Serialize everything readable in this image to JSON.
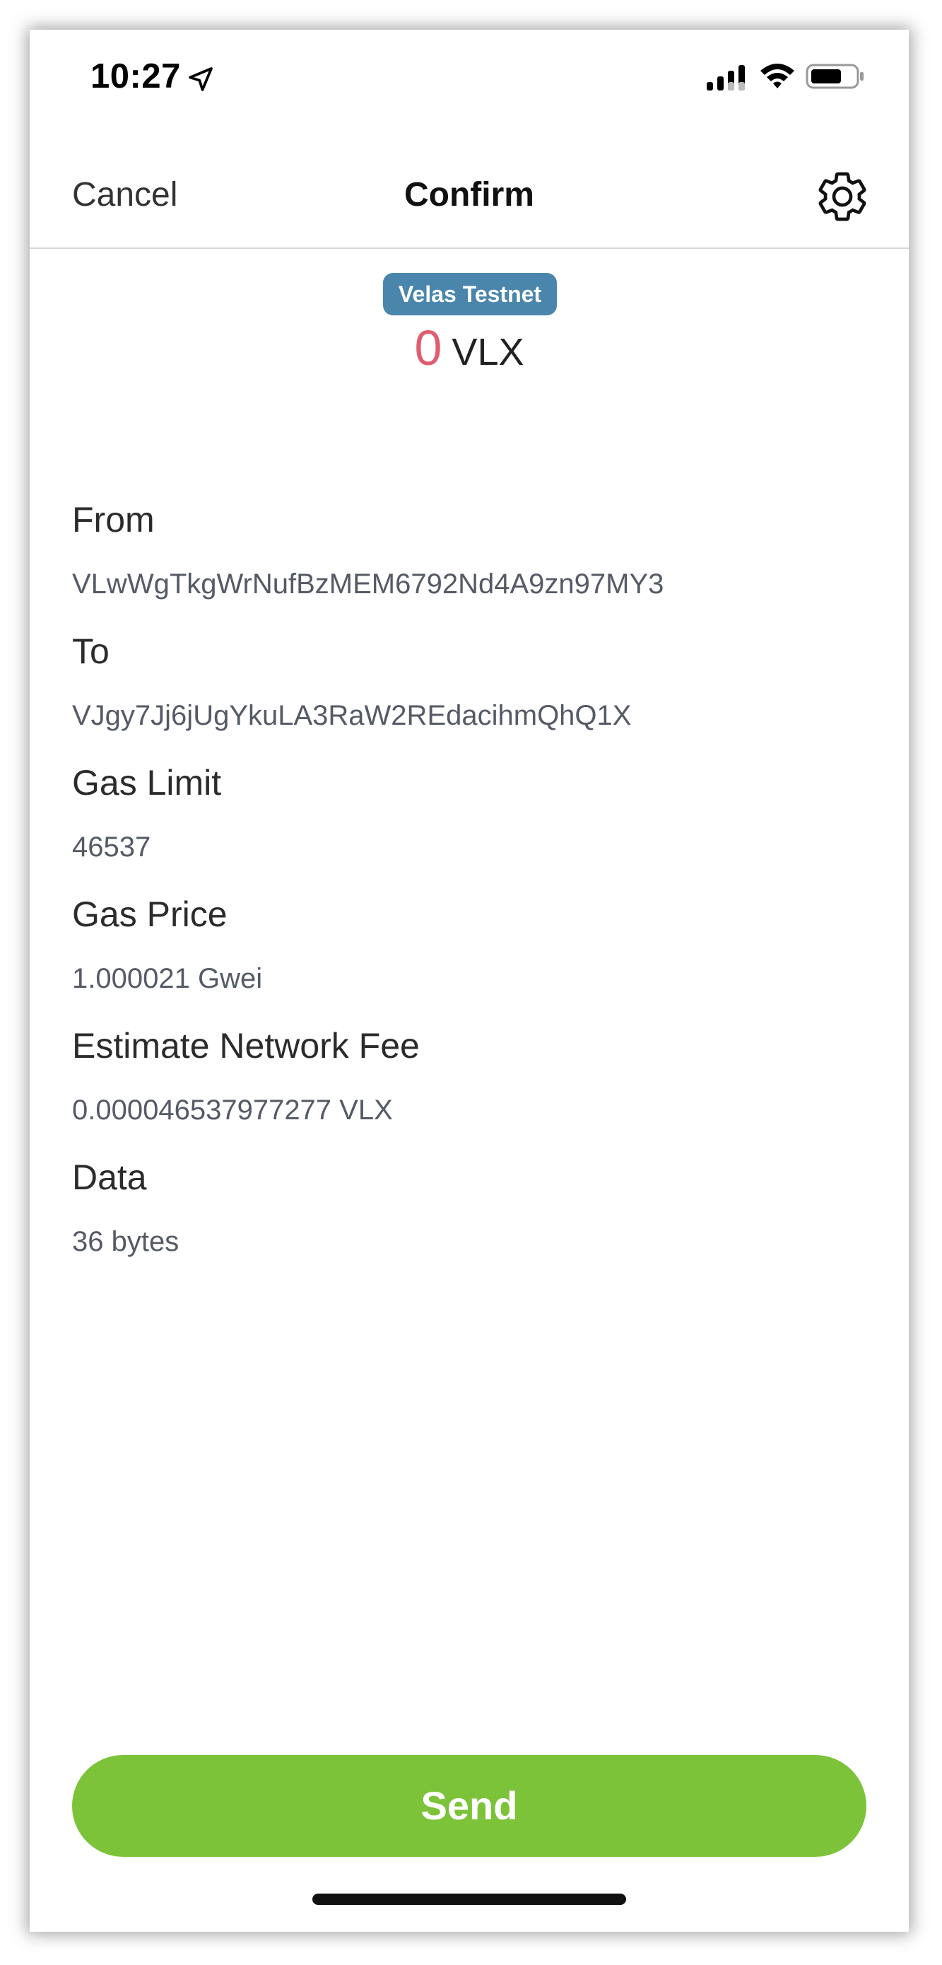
{
  "status_bar": {
    "time": "10:27",
    "icons": [
      "location-arrow-icon",
      "signal-icon",
      "wifi-icon",
      "battery-icon"
    ]
  },
  "nav": {
    "cancel_label": "Cancel",
    "title": "Confirm",
    "settings_icon": "gear-icon"
  },
  "network": {
    "name": "Velas Testnet",
    "color": "#4a86ac"
  },
  "amount": {
    "value": "0",
    "unit": "VLX",
    "value_color": "#e05c6e"
  },
  "fields": {
    "from": {
      "label": "From",
      "value": "VLwWgTkgWrNufBzMEM6792Nd4A9zn97MY3"
    },
    "to": {
      "label": "To",
      "value": "VJgy7Jj6jUgYkuLA3RaW2REdacihmQhQ1X"
    },
    "gas_limit": {
      "label": "Gas Limit",
      "value": "46537"
    },
    "gas_price": {
      "label": "Gas Price",
      "value": "1.000021 Gwei"
    },
    "fee": {
      "label": "Estimate Network Fee",
      "value": "0.000046537977277 VLX"
    },
    "data": {
      "label": "Data",
      "value": "36 bytes"
    }
  },
  "actions": {
    "send_label": "Send",
    "send_color": "#7dc33a"
  }
}
